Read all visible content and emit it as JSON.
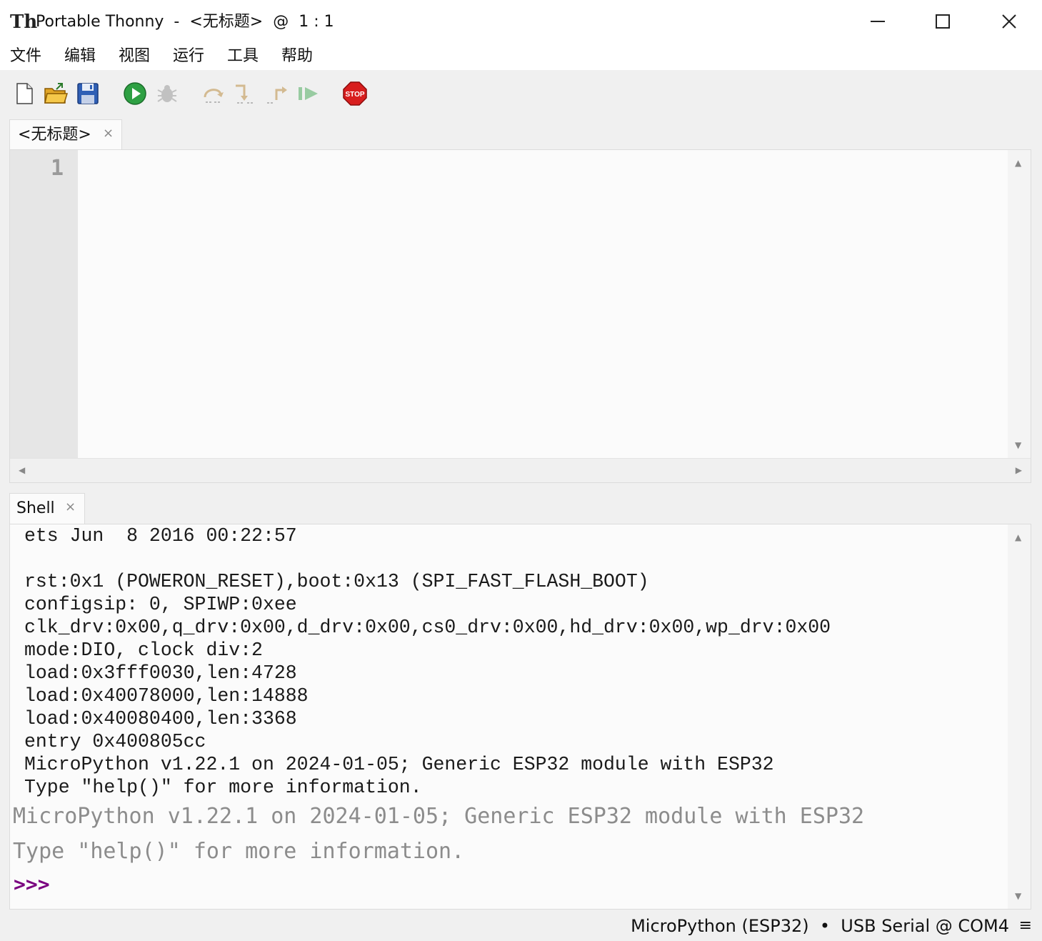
{
  "window": {
    "app_icon_glyph": "Th",
    "title": "Portable Thonny  -  <无标题>  @  1 : 1"
  },
  "menu": {
    "items": [
      "文件",
      "编辑",
      "视图",
      "运行",
      "工具",
      "帮助"
    ]
  },
  "toolbar": {
    "buttons": [
      {
        "icon": "new-file-icon",
        "enabled": true
      },
      {
        "icon": "open-folder-icon",
        "enabled": true
      },
      {
        "icon": "save-disk-icon",
        "enabled": true
      },
      {
        "icon": "run-icon",
        "enabled": true,
        "color": "#2ea043"
      },
      {
        "icon": "debug-bug-icon",
        "enabled": false
      },
      {
        "icon": "step-over-icon",
        "enabled": false
      },
      {
        "icon": "step-into-icon",
        "enabled": false
      },
      {
        "icon": "step-out-icon",
        "enabled": false
      },
      {
        "icon": "resume-icon",
        "enabled": false
      },
      {
        "icon": "stop-icon",
        "enabled": true,
        "color": "#d81e1e",
        "label": "STOP"
      }
    ]
  },
  "editor": {
    "tab_label": "<无标题>",
    "tab_close": "×",
    "line_numbers": [
      "1"
    ],
    "content": ""
  },
  "shell": {
    "tab_label": "Shell",
    "tab_close": "×",
    "boot_lines": [
      "ets Jun  8 2016 00:22:57",
      "",
      "rst:0x1 (POWERON_RESET),boot:0x13 (SPI_FAST_FLASH_BOOT)",
      "configsip: 0, SPIWP:0xee",
      "clk_drv:0x00,q_drv:0x00,d_drv:0x00,cs0_drv:0x00,hd_drv:0x00,wp_drv:0x00",
      "mode:DIO, clock div:2",
      "load:0x3fff0030,len:4728",
      "load:0x40078000,len:14888",
      "load:0x40080400,len:3368",
      "entry 0x400805cc",
      "MicroPython v1.22.1 on 2024-01-05; Generic ESP32 module with ESP32",
      "Type \"help()\" for more information."
    ],
    "banner_lines": [
      "MicroPython v1.22.1 on 2024-01-05; Generic ESP32 module with ESP32",
      "Type \"help()\" for more information."
    ],
    "prompt": ">>>",
    "prompt_color": "#7a0080"
  },
  "status": {
    "text": "MicroPython (ESP32)  •  USB Serial @ COM4",
    "menu_glyph": "≡"
  }
}
